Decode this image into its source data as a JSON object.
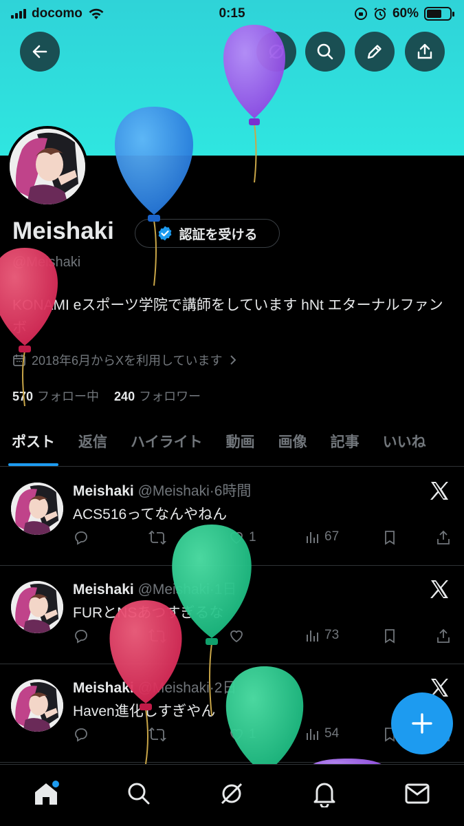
{
  "status_bar": {
    "carrier": "docomo",
    "time": "0:15",
    "battery": "60%"
  },
  "profile": {
    "name": "Meishaki",
    "handle": "@Meishaki",
    "verify_label": "認証を受ける",
    "bio": "KONAMI eスポーツ学院で講師をしています hNt エターナルファンボ",
    "joined": "2018年6月からXを利用しています",
    "following_count": "570",
    "following_label": "フォロー中",
    "followers_count": "240",
    "followers_label": "フォロワー"
  },
  "tabs": [
    {
      "label": "ポスト",
      "active": true
    },
    {
      "label": "返信"
    },
    {
      "label": "ハイライト"
    },
    {
      "label": "動画"
    },
    {
      "label": "画像"
    },
    {
      "label": "記事"
    },
    {
      "label": "いいね"
    }
  ],
  "posts": [
    {
      "name": "Meishaki",
      "handle": "@Meishaki",
      "time": "6時間",
      "text": "ACS516ってなんやねん",
      "likes": "1",
      "views": "67"
    },
    {
      "name": "Meishaki",
      "handle": "@Meishaki",
      "time": "1日",
      "text": "FURとNSあつすぎるな",
      "likes": "",
      "views": "73"
    },
    {
      "name": "Meishaki",
      "handle": "@Meishaki",
      "time": "2日",
      "text": "Haven進化しすぎやん",
      "likes": "1",
      "views": "54"
    }
  ],
  "colors": {
    "banner": "#2fe0df",
    "accent": "#1d9bf0",
    "muted": "#71767b",
    "divider": "#2f3336"
  },
  "icons": {
    "top": [
      "back-arrow-icon",
      "grok-icon",
      "search-icon",
      "edit-pencil-icon",
      "share-icon"
    ],
    "nav": [
      "home-icon",
      "search-icon",
      "grok-icon",
      "notifications-bell-icon",
      "messages-envelope-icon"
    ]
  }
}
